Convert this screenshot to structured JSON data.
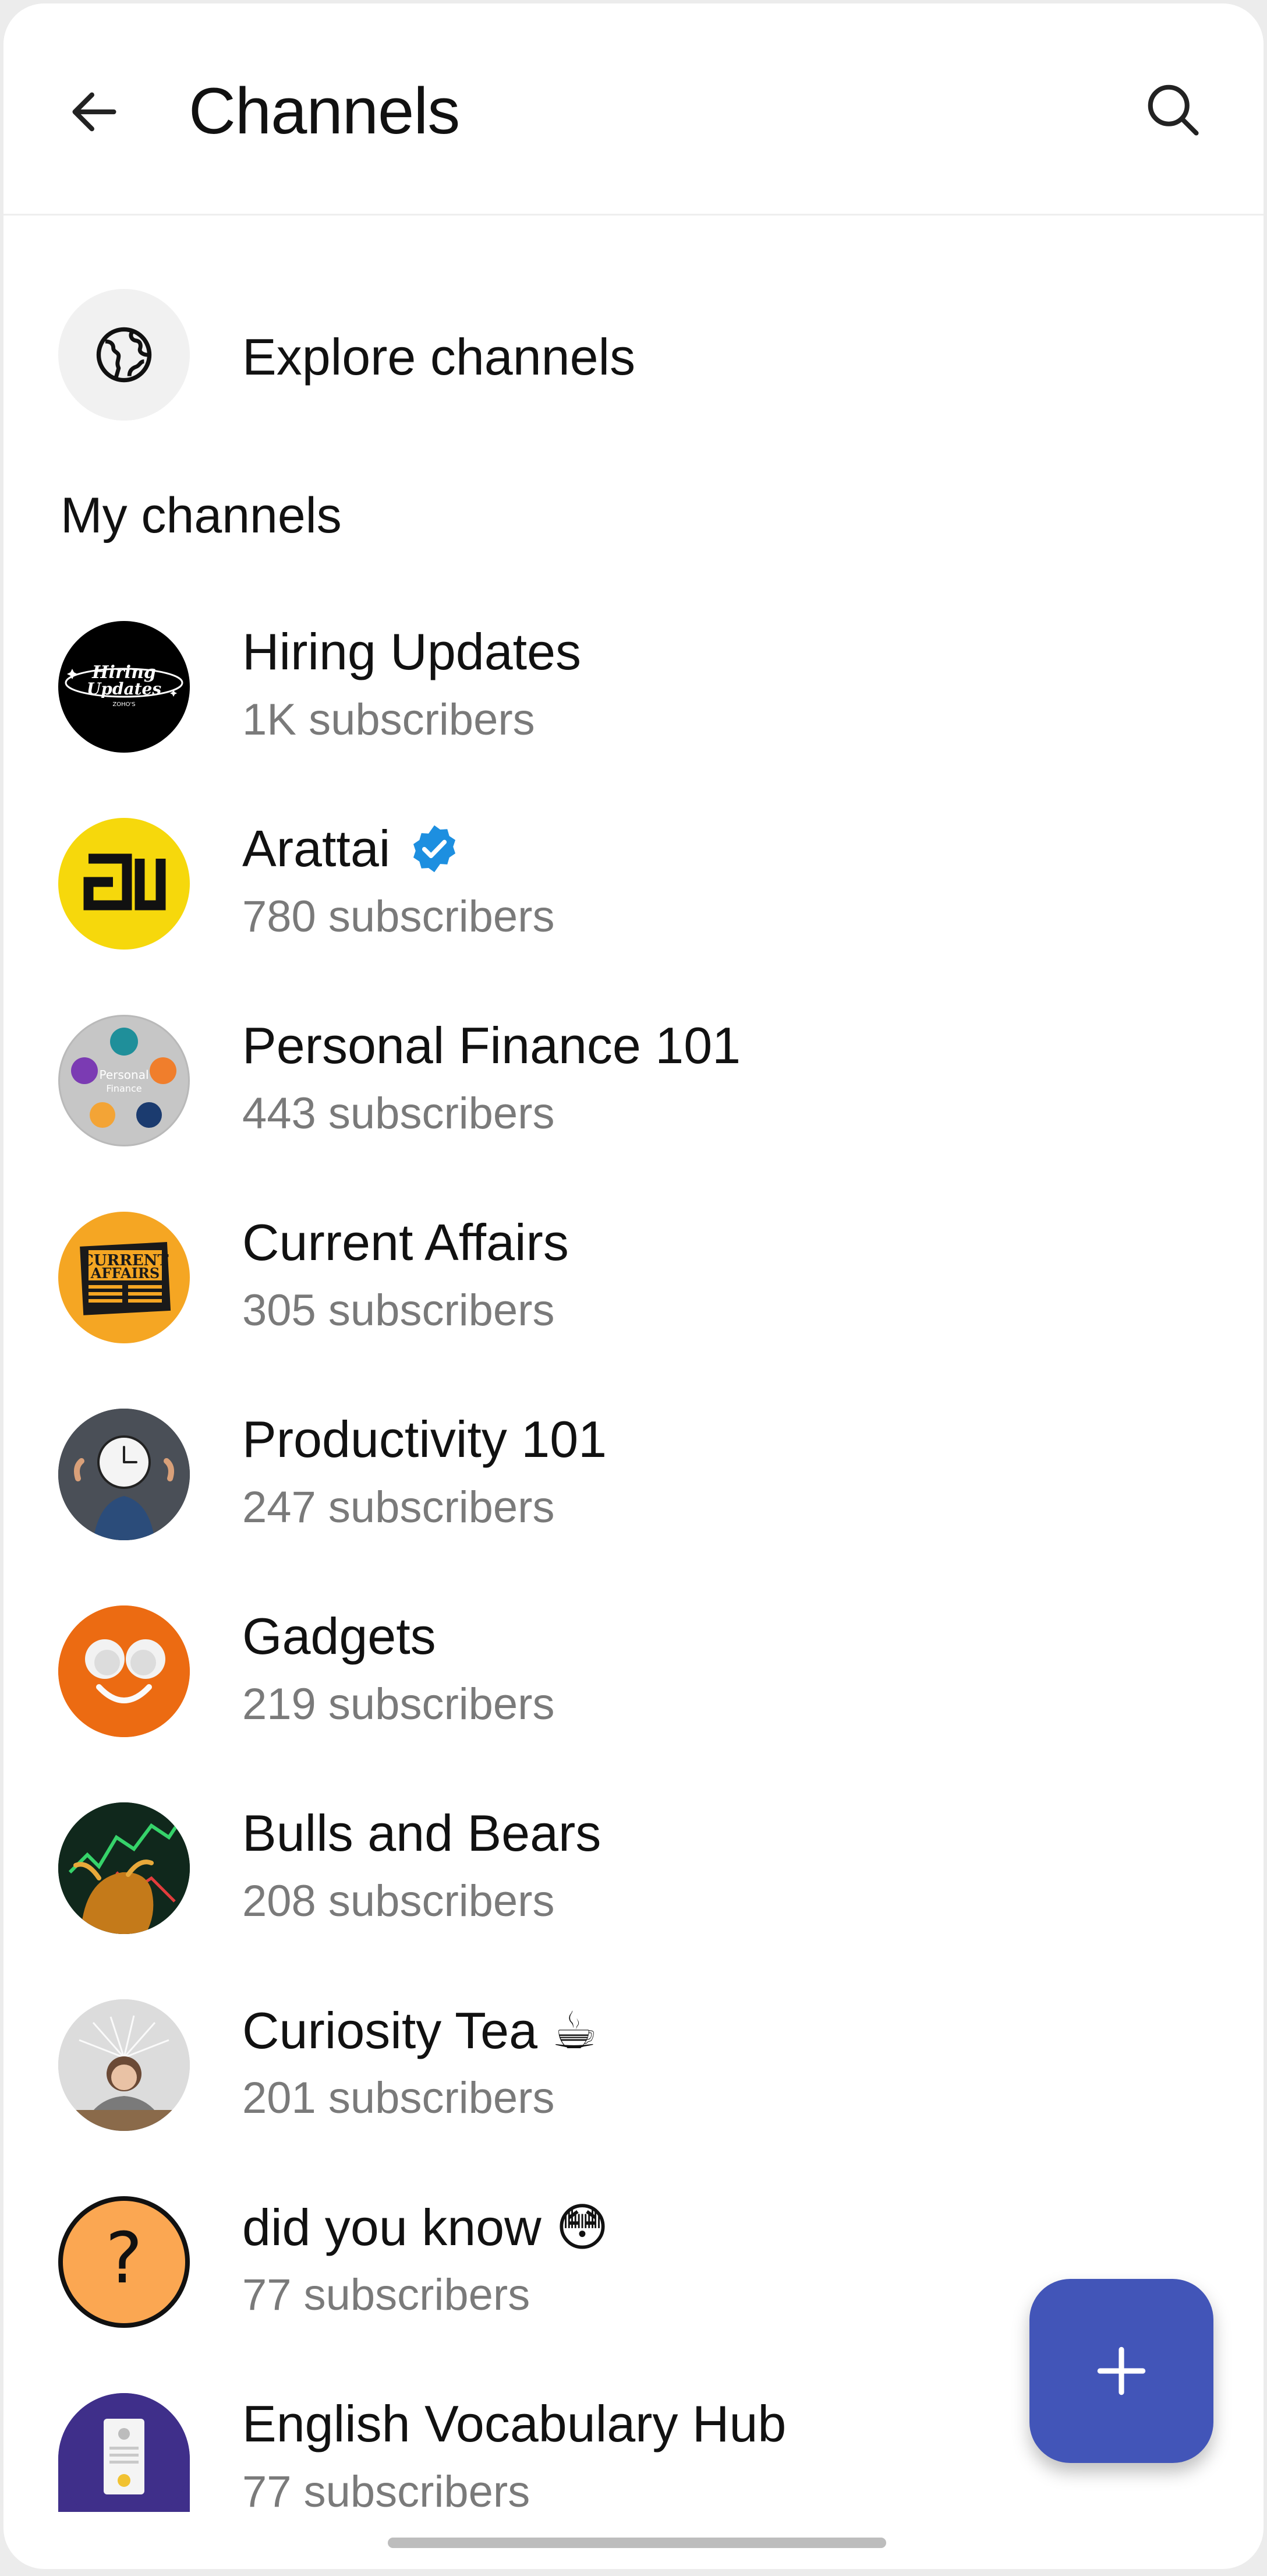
{
  "appbar": {
    "title": "Channels",
    "back_icon": "arrow-left-icon",
    "search_icon": "search-icon"
  },
  "explore": {
    "label": "Explore channels",
    "icon": "globe-icon"
  },
  "section": {
    "my_channels": "My channels"
  },
  "channels": [
    {
      "name": "Hiring Updates",
      "subscribers": "1K subscribers",
      "avatar": "hiring-updates-logo",
      "verified": false
    },
    {
      "name": "Arattai",
      "subscribers": "780 subscribers",
      "avatar": "arattai-logo",
      "verified": true
    },
    {
      "name": "Personal Finance 101",
      "subscribers": "443 subscribers",
      "avatar": "personal-finance-logo",
      "verified": false
    },
    {
      "name": "Current Affairs",
      "subscribers": "305 subscribers",
      "avatar": "current-affairs-logo",
      "verified": false
    },
    {
      "name": "Productivity 101",
      "subscribers": "247 subscribers",
      "avatar": "productivity-logo",
      "verified": false
    },
    {
      "name": "Gadgets",
      "subscribers": "219 subscribers",
      "avatar": "gadgets-logo",
      "verified": false
    },
    {
      "name": "Bulls and Bears",
      "subscribers": "208 subscribers",
      "avatar": "bulls-bears-logo",
      "verified": false
    },
    {
      "name": "Curiosity Tea ☕",
      "subscribers": "201 subscribers",
      "avatar": "curiosity-tea-logo",
      "verified": false
    },
    {
      "name": "did you know 😳",
      "subscribers": "77 subscribers",
      "avatar": "did-you-know-logo",
      "verified": false
    },
    {
      "name": "English Vocabulary Hub",
      "subscribers": "77 subscribers",
      "avatar": "english-vocab-logo",
      "verified": false
    }
  ],
  "hiring_logo_text": {
    "line1": "Hiring",
    "line2": "Updates",
    "line3": "ZOHO'S"
  },
  "current_affairs_logo_text": {
    "line1": "CURRENT",
    "line2": "AFFAIRS"
  },
  "personal_finance_logo_text": {
    "line1": "Personal",
    "line2": "Finance"
  },
  "did_you_know_logo_text": "?",
  "fab": {
    "icon": "plus-icon",
    "color": "#4255b8"
  },
  "colors": {
    "verified": "#1d8fe0",
    "arattai_bg": "#f6d80c",
    "fab": "#4255b8"
  }
}
